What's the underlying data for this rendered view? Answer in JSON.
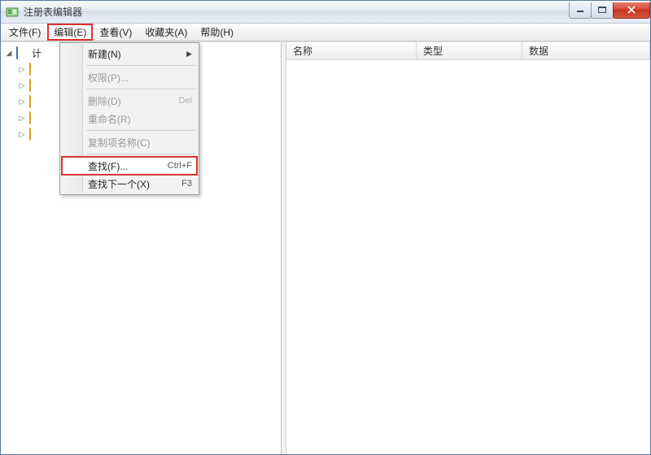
{
  "window": {
    "title": "注册表编辑器"
  },
  "menubar": {
    "file": "文件(F)",
    "edit": "编辑(E)",
    "view": "查看(V)",
    "favorites": "收藏夹(A)",
    "help": "帮助(H)"
  },
  "tree": {
    "root_label": "计",
    "nodes": [
      {
        "label": ""
      },
      {
        "label": ""
      },
      {
        "label": ""
      },
      {
        "label": ""
      },
      {
        "label": ""
      }
    ]
  },
  "edit_menu": {
    "new": {
      "label": "新建(N)"
    },
    "permissions": {
      "label": "权限(P)..."
    },
    "delete": {
      "label": "删除(D)",
      "shortcut": "Del"
    },
    "rename": {
      "label": "重命名(R)"
    },
    "copy_key_name": {
      "label": "复制项名称(C)"
    },
    "find": {
      "label": "查找(F)...",
      "shortcut": "Ctrl+F"
    },
    "find_next": {
      "label": "查找下一个(X)",
      "shortcut": "F3"
    }
  },
  "list": {
    "columns": {
      "name": "名称",
      "type": "类型",
      "data": "数据"
    }
  },
  "highlights": {
    "menu_edit": true,
    "menu_find": true
  }
}
